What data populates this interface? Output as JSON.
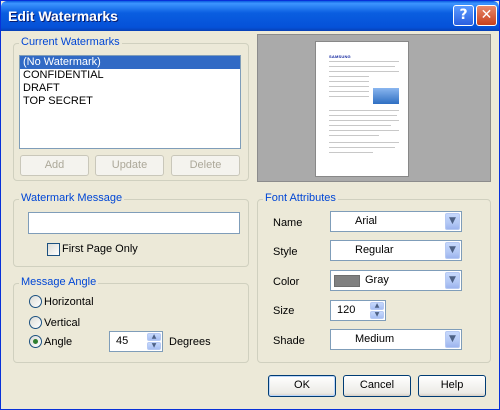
{
  "window": {
    "title": "Edit Watermarks"
  },
  "titlebar": {
    "help_glyph": "?",
    "close_glyph": "✕"
  },
  "current_watermarks": {
    "legend": "Current Watermarks",
    "items": [
      "(No Watermark)",
      "CONFIDENTIAL",
      "DRAFT",
      "TOP SECRET"
    ],
    "selected_index": 0,
    "add_label": "Add",
    "update_label": "Update",
    "delete_label": "Delete"
  },
  "preview": {
    "logo_text": "SAMSUNG",
    "logo_color": "#1428a0",
    "image_color": "#3a78c9"
  },
  "watermark_message": {
    "legend": "Watermark Message",
    "value": "",
    "first_page_only_label": "First Page Only",
    "first_page_only_checked": false
  },
  "message_angle": {
    "legend": "Message Angle",
    "options": [
      "Horizontal",
      "Vertical",
      "Angle"
    ],
    "selected": "Angle",
    "angle_value": "45",
    "degrees_label": "Degrees"
  },
  "font_attributes": {
    "legend": "Font Attributes",
    "name_label": "Name",
    "name_value": "Arial",
    "style_label": "Style",
    "style_value": "Regular",
    "color_label": "Color",
    "color_value": "Gray",
    "color_swatch": "#808080",
    "size_label": "Size",
    "size_value": "120",
    "shade_label": "Shade",
    "shade_value": "Medium"
  },
  "footer": {
    "ok_label": "OK",
    "cancel_label": "Cancel",
    "help_label": "Help"
  },
  "icons": {
    "dropdown": "▼",
    "spin_up": "▲",
    "spin_down": "▼"
  },
  "colors": {
    "title_bar": "#0a5ee0",
    "group_legend": "#0046d5",
    "selection": "#316ac5"
  }
}
